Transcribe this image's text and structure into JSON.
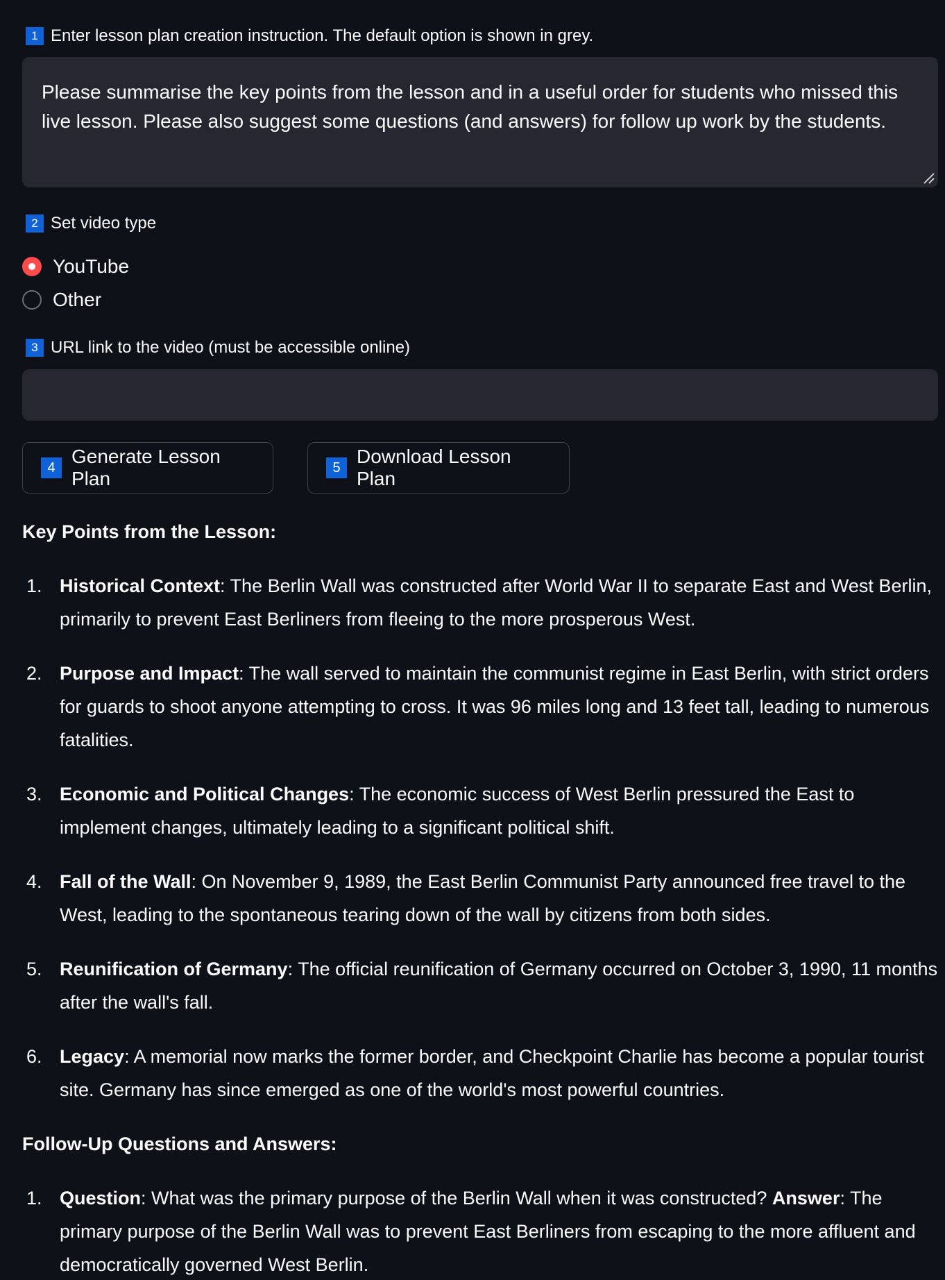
{
  "step1": {
    "badge": "1",
    "label": "Enter lesson plan creation instruction. The default option is shown in grey.",
    "textarea_value": "Please summarise the key points from the lesson and in a useful order for students who missed this live lesson. Please also suggest some questions (and answers) for follow up work by the students."
  },
  "step2": {
    "badge": "2",
    "label": "Set video type",
    "options": [
      {
        "label": "YouTube",
        "selected": true
      },
      {
        "label": "Other",
        "selected": false
      }
    ]
  },
  "step3": {
    "badge": "3",
    "label": "URL link to the video (must be accessible online)",
    "value": "",
    "placeholder": ""
  },
  "buttons": {
    "generate": {
      "badge": "4",
      "label": "Generate Lesson Plan"
    },
    "download": {
      "badge": "5",
      "label": "Download Lesson Plan"
    }
  },
  "key_points": {
    "heading": "Key Points from the Lesson:",
    "items": [
      {
        "num": "1.",
        "title": "Historical Context",
        "text": ": The Berlin Wall was constructed after World War II to separate East and West Berlin, primarily to prevent East Berliners from fleeing to the more prosperous West."
      },
      {
        "num": "2.",
        "title": "Purpose and Impact",
        "text": ": The wall served to maintain the communist regime in East Berlin, with strict orders for guards to shoot anyone attempting to cross. It was 96 miles long and 13 feet tall, leading to numerous fatalities."
      },
      {
        "num": "3.",
        "title": "Economic and Political Changes",
        "text": ": The economic success of West Berlin pressured the East to implement changes, ultimately leading to a significant political shift."
      },
      {
        "num": "4.",
        "title": "Fall of the Wall",
        "text": ": On November 9, 1989, the East Berlin Communist Party announced free travel to the West, leading to the spontaneous tearing down of the wall by citizens from both sides."
      },
      {
        "num": "5.",
        "title": "Reunification of Germany",
        "text": ": The official reunification of Germany occurred on October 3, 1990, 11 months after the wall's fall."
      },
      {
        "num": "6.",
        "title": "Legacy",
        "text": ": A memorial now marks the former border, and Checkpoint Charlie has become a popular tourist site. Germany has since emerged as one of the world's most powerful countries."
      }
    ]
  },
  "follow_up": {
    "heading": "Follow-Up Questions and Answers:",
    "items": [
      {
        "num": "1.",
        "q_label": "Question",
        "question": ": What was the primary purpose of the Berlin Wall when it was constructed? ",
        "a_label": "Answer",
        "answer": ": The primary purpose of the Berlin Wall was to prevent East Berliners from escaping to the more affluent and democratically governed West Berlin."
      }
    ]
  },
  "colors": {
    "background": "#0e1117",
    "input_bg": "#262730",
    "badge": "#0f62d8",
    "radio_selected": "#ff4b4b"
  }
}
